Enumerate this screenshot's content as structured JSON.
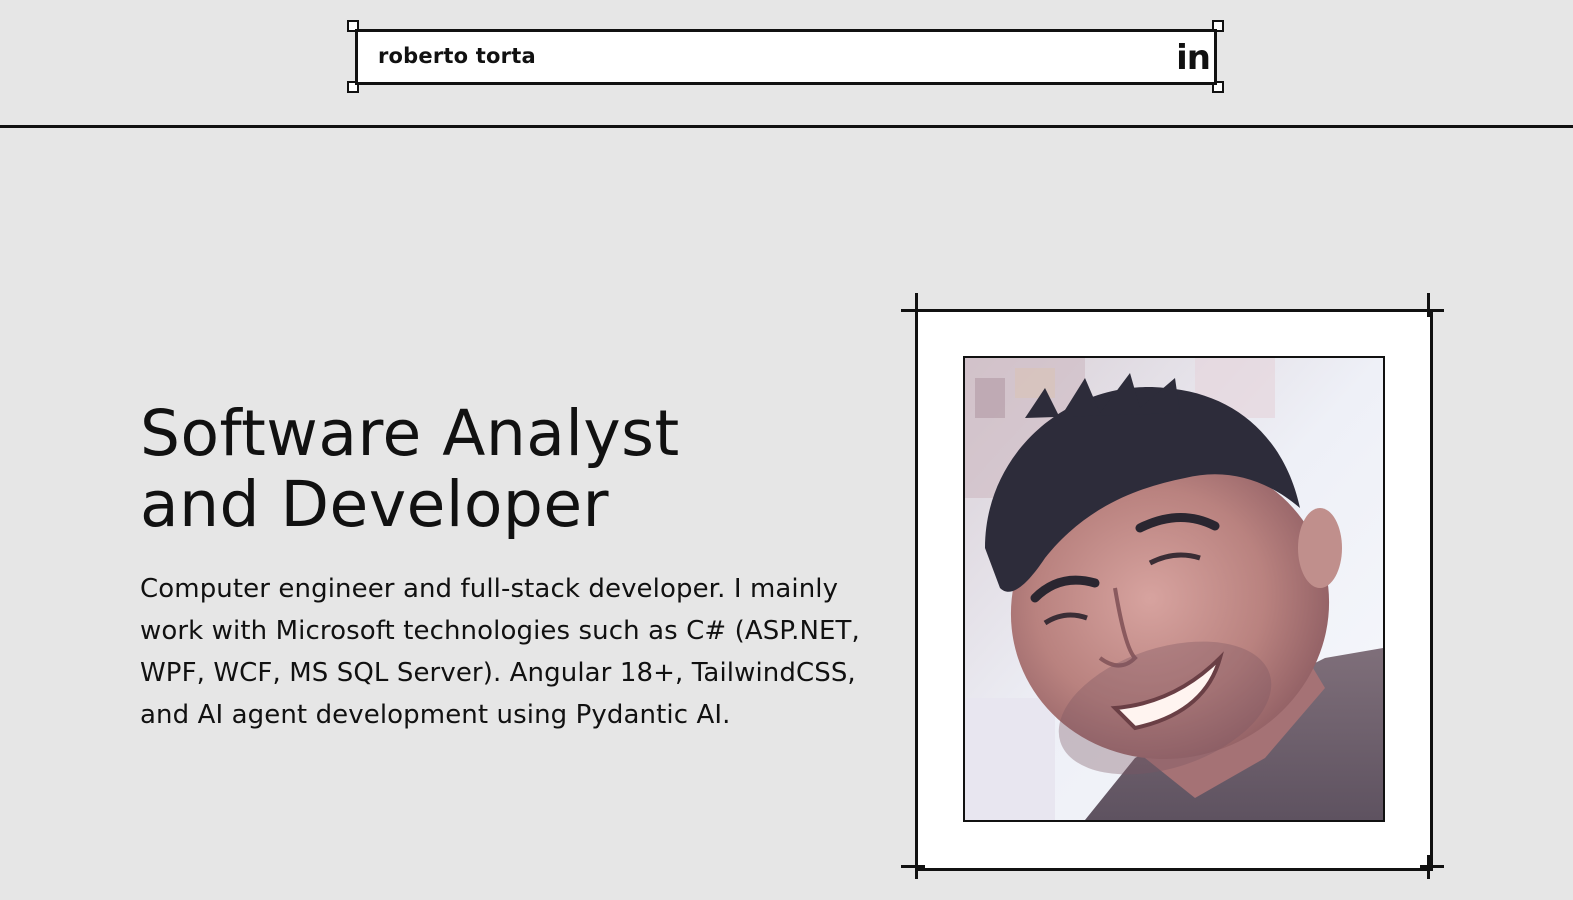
{
  "header": {
    "brand": "roberto torta",
    "linkedin_label": "in"
  },
  "hero": {
    "title_line1": "Software Analyst",
    "title_line2": "and Developer",
    "description": "Computer engineer and full-stack developer. I mainly work with Microsoft technologies such as C# (ASP.NET, WPF, WCF, MS SQL Server). Angular 18+, TailwindCSS, and AI agent development using Pydantic AI."
  },
  "photo": {
    "icon": "profile-photo"
  },
  "colors": {
    "background": "#e6e6e6",
    "ink": "#111111",
    "panel": "#ffffff"
  }
}
